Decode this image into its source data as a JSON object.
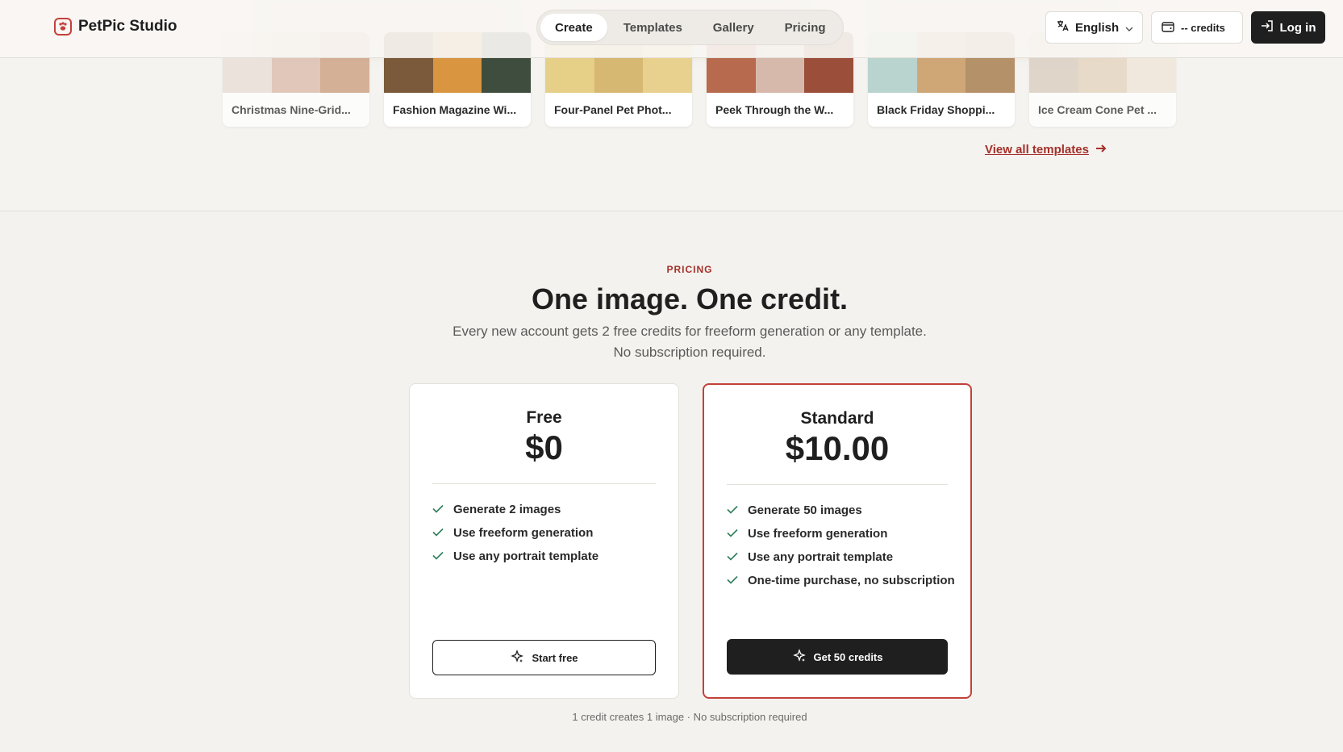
{
  "brand": {
    "name": "PetPic Studio",
    "accent": "#c2413a"
  },
  "nav": {
    "items": [
      {
        "label": "Create",
        "active": true
      },
      {
        "label": "Templates",
        "active": false
      },
      {
        "label": "Gallery",
        "active": false
      },
      {
        "label": "Pricing",
        "active": false
      }
    ]
  },
  "header": {
    "language": "English",
    "credits": "-- credits",
    "login": "Log in"
  },
  "templates": {
    "cards": [
      {
        "title": "Christmas Nine-Grid..."
      },
      {
        "title": "Fashion Magazine Wi..."
      },
      {
        "title": "Four-Panel Pet Phot..."
      },
      {
        "title": "Peek Through the W..."
      },
      {
        "title": "Black Friday Shoppi..."
      },
      {
        "title": "Ice Cream Cone Pet ..."
      }
    ],
    "view_all": "View all templates"
  },
  "pricing": {
    "eyebrow": "PRICING",
    "headline": "One image. One credit.",
    "subtitle": "Every new account gets 2 free credits for freeform generation or any template. No subscription required.",
    "plans": [
      {
        "name": "Free",
        "price": "$0",
        "features": [
          "Generate 2 images",
          "Use freeform generation",
          "Use any portrait template"
        ],
        "cta": "Start free"
      },
      {
        "name": "Standard",
        "price": "$10.00",
        "features": [
          "Generate 50 images",
          "Use freeform generation",
          "Use any portrait template",
          "One-time purchase, no subscription"
        ],
        "cta": "Get 50 credits"
      }
    ],
    "footnote": "1 credit creates 1 image · No subscription required"
  },
  "colors": {
    "check": "#2e7d5b",
    "link": "#a3302a",
    "dark": "#1f1f1f"
  }
}
